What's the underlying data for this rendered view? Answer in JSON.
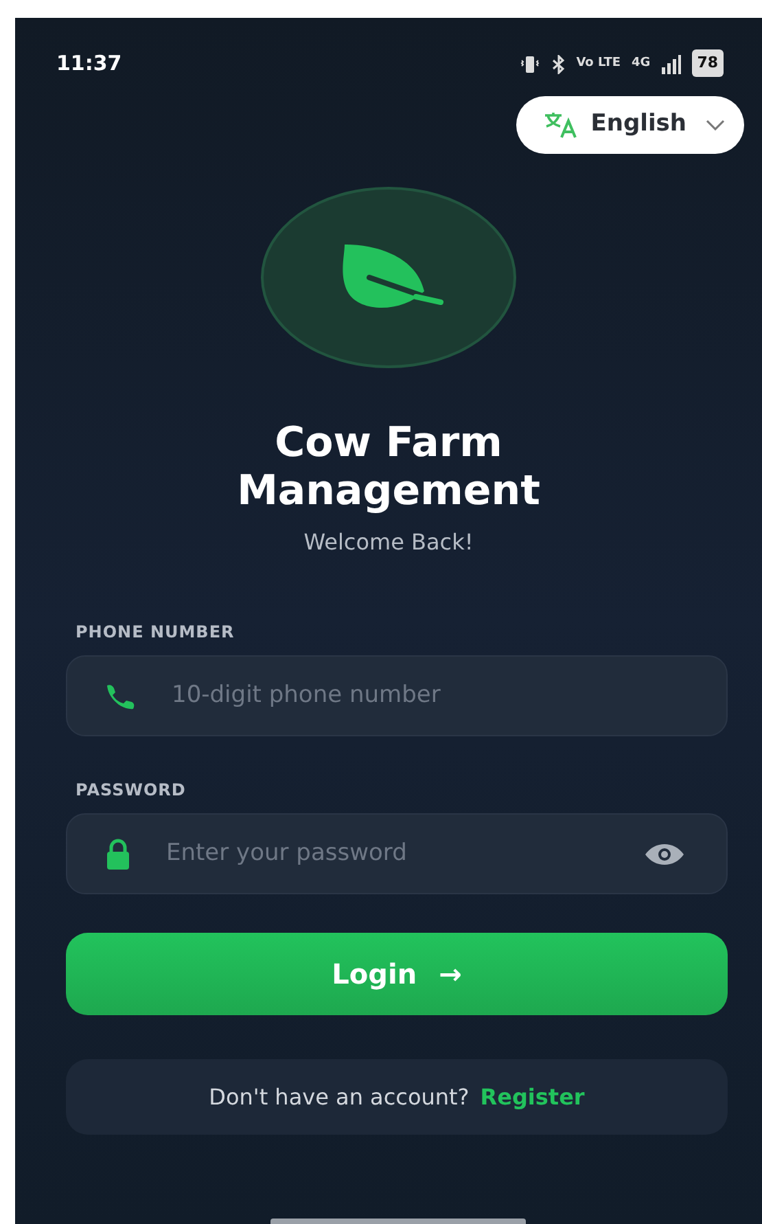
{
  "status_bar": {
    "time": "11:37",
    "network_texts": [
      "Vo LTE",
      "4G"
    ],
    "battery": "78"
  },
  "language_button": {
    "label": "English"
  },
  "app": {
    "title": "Cow Farm Management",
    "subtitle": "Welcome Back!"
  },
  "fields": [
    {
      "kind": "phone",
      "label": "PHONE NUMBER",
      "placeholder": "10-digit phone number"
    },
    {
      "kind": "password",
      "label": "PASSWORD",
      "placeholder": "Enter your password"
    }
  ],
  "login_button": {
    "label": "Login",
    "arrow": "→"
  },
  "register": {
    "prompt": "Don't have an account?",
    "link": "Register"
  }
}
